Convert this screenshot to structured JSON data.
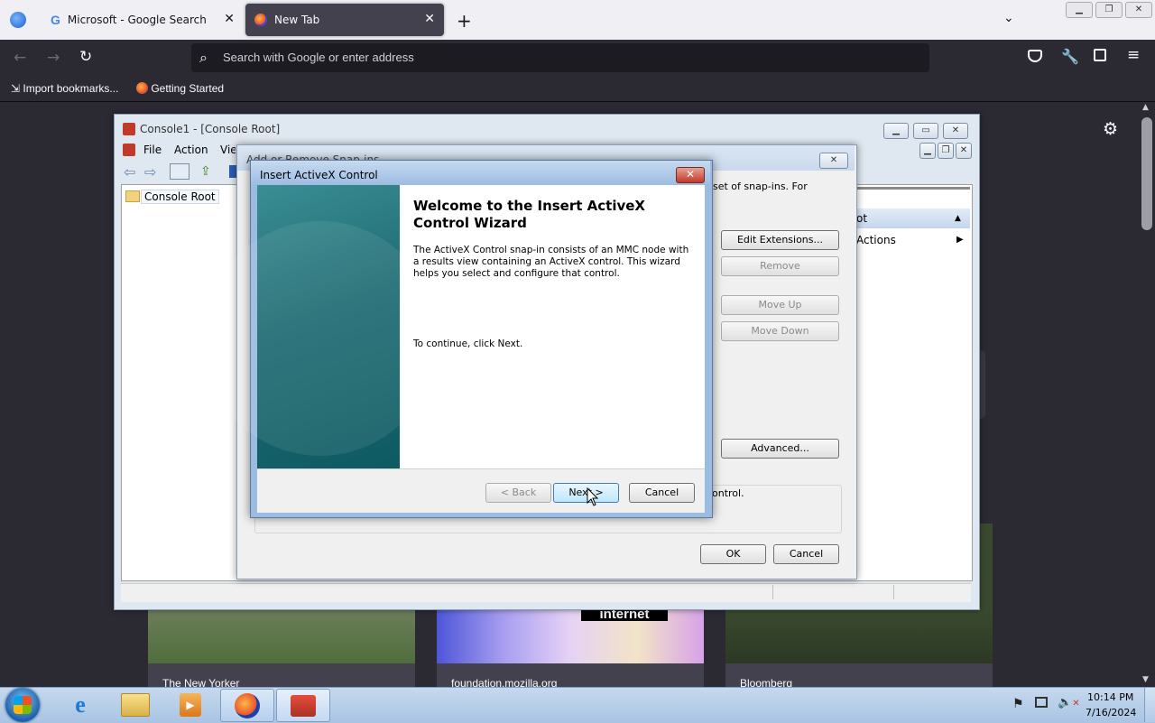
{
  "browser": {
    "tabs": [
      {
        "title": "Microsoft - Google Search",
        "icon": "google-icon"
      },
      {
        "title": "New Tab",
        "icon": "firefox-icon"
      }
    ],
    "address_placeholder": "Search with Google or enter address",
    "bookmarks": [
      {
        "label": "Import bookmarks...",
        "icon": "import-icon"
      },
      {
        "label": "Getting Started",
        "icon": "firefox-icon"
      }
    ]
  },
  "newtab": {
    "tiles": [
      {
        "label": "The New Yorker"
      },
      {
        "label": "foundation.mozilla.org",
        "overlay": "internet"
      },
      {
        "label": "Bloomberg"
      }
    ]
  },
  "mmc": {
    "title": "Console1 - [Console Root]",
    "menu": [
      "File",
      "Action",
      "View"
    ],
    "tree_root": "Console Root",
    "actions_header": "Console Root",
    "actions_header_visible": "ot",
    "actions_item": "More Actions",
    "actions_item_visible": "Actions"
  },
  "add_remove": {
    "title": "Add or Remove Snap-ins",
    "desc_fragment": "set of snap-ins. For",
    "buttons": {
      "edit_extensions": "Edit Extensions...",
      "remove": "Remove",
      "move_up": "Move Up",
      "move_down": "Move Down",
      "advanced": "Advanced...",
      "ok": "OK",
      "cancel": "Cancel"
    },
    "desc_box_fragment": "ontrol."
  },
  "wizard": {
    "title": "Insert ActiveX Control",
    "heading_line1": "Welcome to the Insert ActiveX",
    "heading_line2": "Control Wizard",
    "body_line1": "The ActiveX Control snap-in consists of an MMC node with",
    "body_line2": "a results view containing an ActiveX control. This wizard",
    "body_line3": "helps you select and configure that control.",
    "continue_text": "To continue, click Next.",
    "back_label": "< Back",
    "next_label": "Next >",
    "cancel_label": "Cancel"
  },
  "taskbar": {
    "time": "10:14 PM",
    "date": "7/16/2024",
    "apps": [
      "start-orb-icon",
      "internet-explorer-icon",
      "file-explorer-icon",
      "media-player-icon",
      "firefox-icon",
      "mmc-toolbox-icon"
    ]
  },
  "colors": {
    "firefox_dark": "#2b2a33",
    "wizard_teal": "#1f6b73",
    "taskbar_blue": "#a9c4e3"
  }
}
